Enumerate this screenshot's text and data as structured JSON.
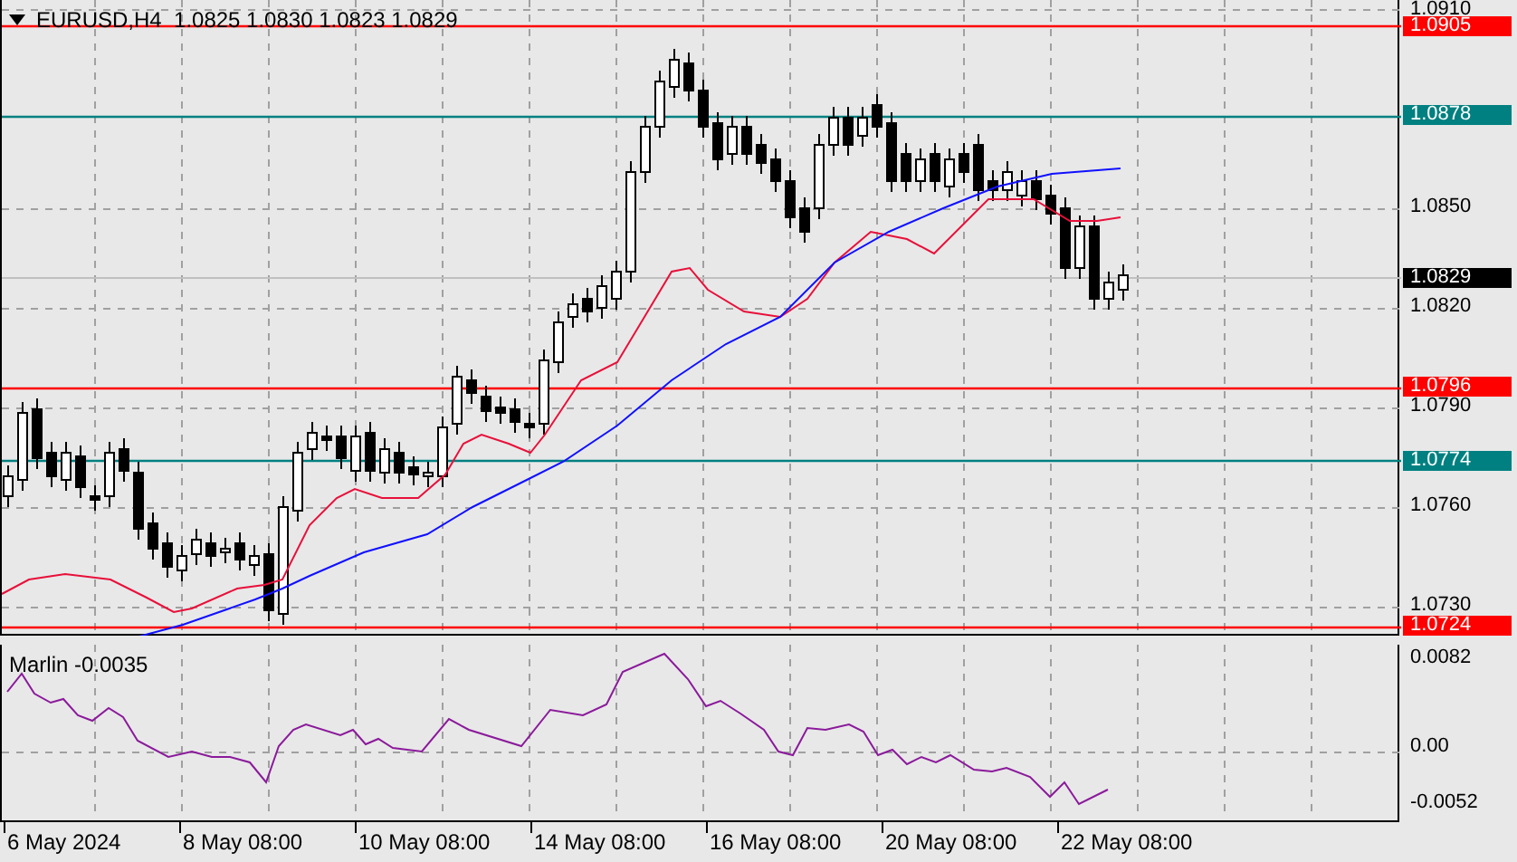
{
  "chart": {
    "title": "EURUSD,H4  1.0825 1.0830 1.0823 1.0829",
    "price_ticks": [
      "1.0910",
      "1.0850",
      "1.0820",
      "1.0790",
      "1.0760",
      "1.0730"
    ],
    "levels": [
      {
        "price": "1.0905",
        "color": "#ff0000"
      },
      {
        "price": "1.0878",
        "color": "#008080"
      },
      {
        "price": "1.0796",
        "color": "#ff0000"
      },
      {
        "price": "1.0774",
        "color": "#008080"
      },
      {
        "price": "1.0724",
        "color": "#ff0000"
      }
    ],
    "current_price": "1.0829"
  },
  "indicator": {
    "name": "Marlin -0.0035",
    "ticks": [
      "0.0082",
      "0.00",
      "-0.0052"
    ]
  },
  "time_axis": [
    "6 May 2024",
    "8 May 08:00",
    "10 May 08:00",
    "14 May 08:00",
    "16 May 08:00",
    "20 May 08:00",
    "22 May 08:00"
  ]
}
